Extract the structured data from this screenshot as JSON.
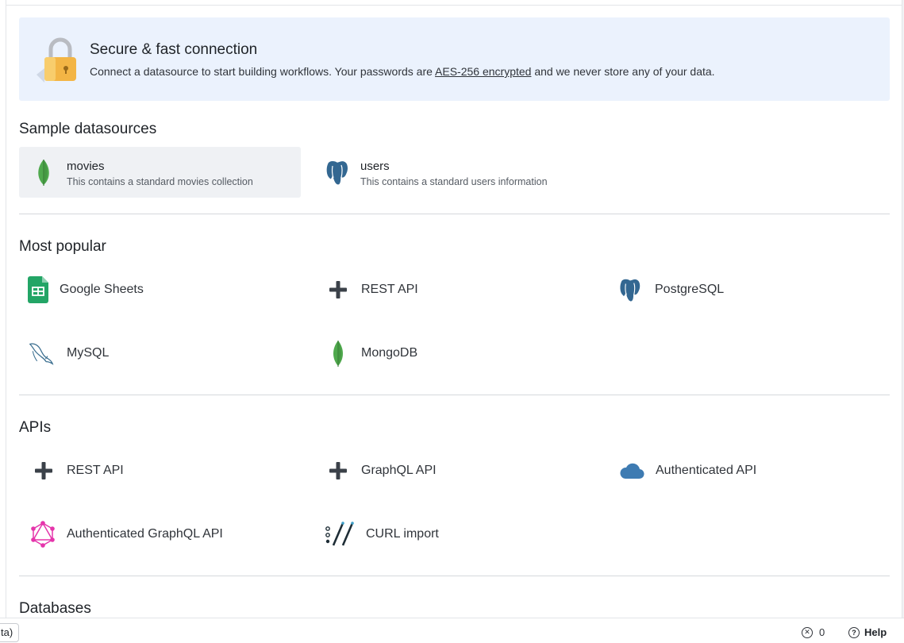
{
  "banner": {
    "title": "Secure & fast connection",
    "desc_before": "Connect a datasource to start building workflows. Your passwords are ",
    "desc_link": "AES-256 encrypted",
    "desc_after": " and we never store any of your data."
  },
  "sample": {
    "heading": "Sample datasources",
    "items": [
      {
        "name": "movies",
        "sub": "This contains a standard movies collection",
        "icon": "mongodb-leaf-icon"
      },
      {
        "name": "users",
        "sub": "This contains a standard users information",
        "icon": "postgresql-elephant-icon"
      }
    ]
  },
  "popular": {
    "heading": "Most popular",
    "items": [
      {
        "label": "Google Sheets",
        "icon": "google-sheets-icon"
      },
      {
        "label": "REST API",
        "icon": "plus-icon"
      },
      {
        "label": "PostgreSQL",
        "icon": "postgresql-elephant-icon"
      },
      {
        "label": "MySQL",
        "icon": "mysql-dolphin-icon"
      },
      {
        "label": "MongoDB",
        "icon": "mongodb-leaf-icon"
      }
    ]
  },
  "apis": {
    "heading": "APIs",
    "items": [
      {
        "label": "REST API",
        "icon": "plus-icon"
      },
      {
        "label": "GraphQL API",
        "icon": "plus-icon"
      },
      {
        "label": "Authenticated API",
        "icon": "cloud-icon"
      },
      {
        "label": "Authenticated GraphQL API",
        "icon": "graphql-icon"
      },
      {
        "label": "CURL import",
        "icon": "curl-icon"
      }
    ]
  },
  "databases": {
    "heading": "Databases"
  },
  "statusbar": {
    "tab_stub": "ta)",
    "error_count": "0",
    "help": "Help"
  },
  "colors": {
    "banner_bg": "#ebf2fd",
    "active_card": "#eff1f4",
    "graphql": "#e535ab",
    "sheets": "#23a566",
    "mongo": "#4fa94d",
    "cloud": "#3e7bb2"
  }
}
